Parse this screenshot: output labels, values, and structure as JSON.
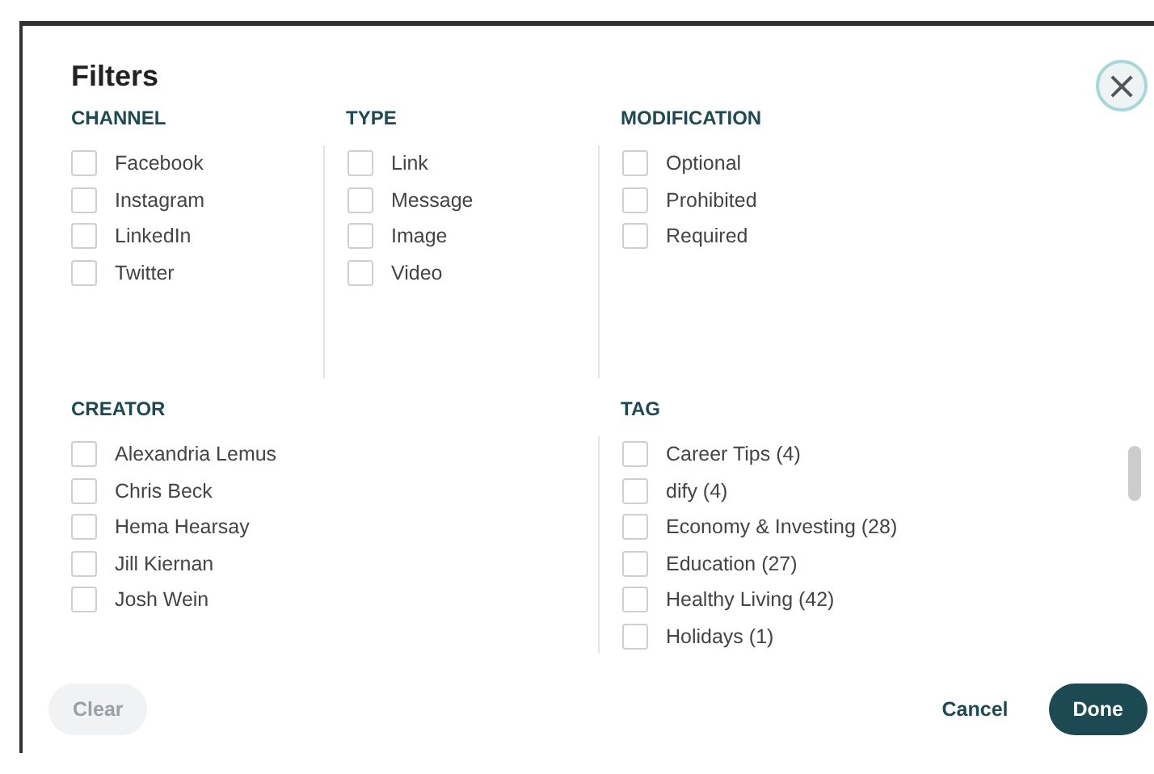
{
  "title": "Filters",
  "close": {
    "label": "×"
  },
  "sections": [
    {
      "heading": "CHANNEL",
      "options": [
        {
          "label": "Facebook",
          "checked": false
        },
        {
          "label": "Instagram",
          "checked": false
        },
        {
          "label": "LinkedIn",
          "checked": false
        },
        {
          "label": "Twitter",
          "checked": false
        }
      ]
    },
    {
      "heading": "TYPE",
      "options": [
        {
          "label": "Link",
          "checked": false
        },
        {
          "label": "Message",
          "checked": false
        },
        {
          "label": "Image",
          "checked": false
        },
        {
          "label": "Video",
          "checked": false
        }
      ]
    },
    {
      "heading": "MODIFICATION",
      "options": [
        {
          "label": "Optional",
          "checked": false
        },
        {
          "label": "Prohibited",
          "checked": false
        },
        {
          "label": "Required",
          "checked": false
        }
      ]
    },
    {
      "heading": "CREATOR",
      "options": [
        {
          "label": "Alexandria Lemus",
          "checked": false
        },
        {
          "label": "Chris Beck",
          "checked": false
        },
        {
          "label": "Hema Hearsay",
          "checked": false
        },
        {
          "label": "Jill Kiernan",
          "checked": false
        },
        {
          "label": "Josh Wein",
          "checked": false
        }
      ]
    },
    {
      "heading": "TAG",
      "options": [
        {
          "label": "Career Tips (4)",
          "checked": false
        },
        {
          "label": "dify (4)",
          "checked": false
        },
        {
          "label": "Economy & Investing (28)",
          "checked": false
        },
        {
          "label": "Education (27)",
          "checked": false
        },
        {
          "label": "Healthy Living (42)",
          "checked": false
        },
        {
          "label": "Holidays (1)",
          "checked": false
        }
      ]
    }
  ],
  "buttons": [
    {
      "label": "Clear",
      "kind": "ghost"
    },
    {
      "label": "Cancel",
      "kind": "text"
    },
    {
      "label": "Done",
      "kind": "primary"
    }
  ]
}
